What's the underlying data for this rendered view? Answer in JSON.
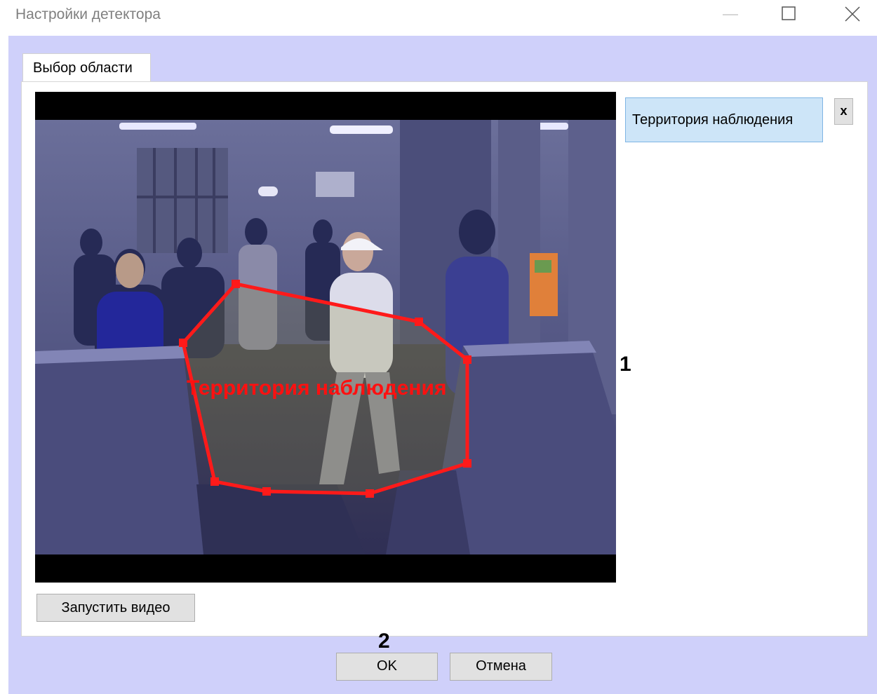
{
  "window": {
    "title": "Настройки детектора",
    "controls": [
      "minimize-icon",
      "maximize-icon",
      "close-icon"
    ]
  },
  "tabs": [
    {
      "label": "Выбор области",
      "active": true
    }
  ],
  "video": {
    "zone_label": "Территория наблюдения",
    "zone_color": "#ff0000",
    "start_button_label": "Запустить видео"
  },
  "zone_list": {
    "items": [
      {
        "label": "Территория наблюдения",
        "selected": true
      }
    ],
    "remove_label": "x"
  },
  "footer": {
    "ok_label": "OK",
    "cancel_label": "Отмена"
  },
  "callouts": {
    "marker_1": "1",
    "marker_2": "2"
  },
  "colors": {
    "client_background": "#cfd0fa",
    "selection_background": "#cde5f8",
    "selection_border": "#7fb5e4"
  }
}
